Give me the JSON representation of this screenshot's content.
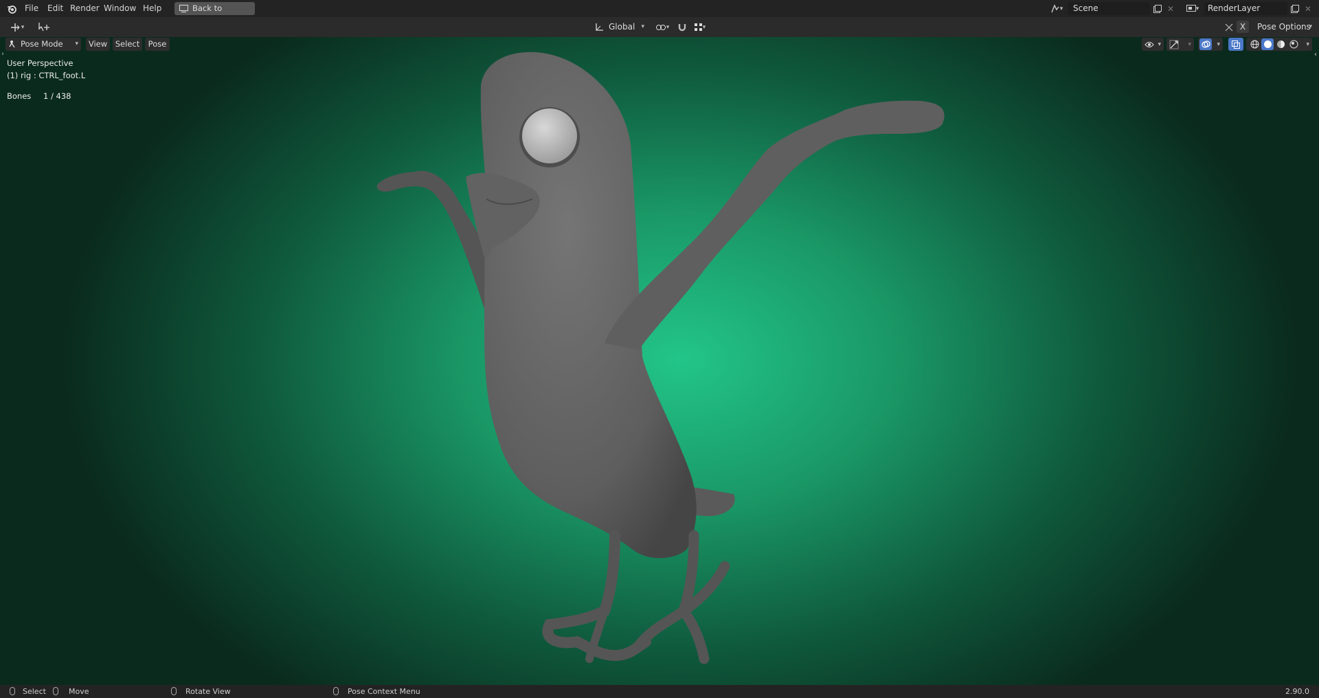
{
  "topbar": {
    "menu": [
      "File",
      "Edit",
      "Render",
      "Window",
      "Help"
    ],
    "back_button": "Back to Previous",
    "scene": "Scene",
    "render_layer": "RenderLayer"
  },
  "toolbar2": {
    "orientation": "Global",
    "pose_options": "Pose Options",
    "x_toggle": "X"
  },
  "viewport_header": {
    "mode": "Pose Mode",
    "menus": [
      "View",
      "Select",
      "Pose"
    ]
  },
  "overlay": {
    "perspective": "User Perspective",
    "active": "(1) rig : CTRL_foot.L",
    "bones_label": "Bones",
    "bones_count": "1 / 438"
  },
  "statusbar": {
    "select": "Select",
    "move": "Move",
    "rotate": "Rotate View",
    "context": "Pose Context Menu",
    "version": "2.90.0"
  },
  "colors": {
    "viewport_center": "#22c589",
    "viewport_edge": "#0a2a1d",
    "accent_blue": "#4a78c8",
    "model_gray": "#636363"
  }
}
